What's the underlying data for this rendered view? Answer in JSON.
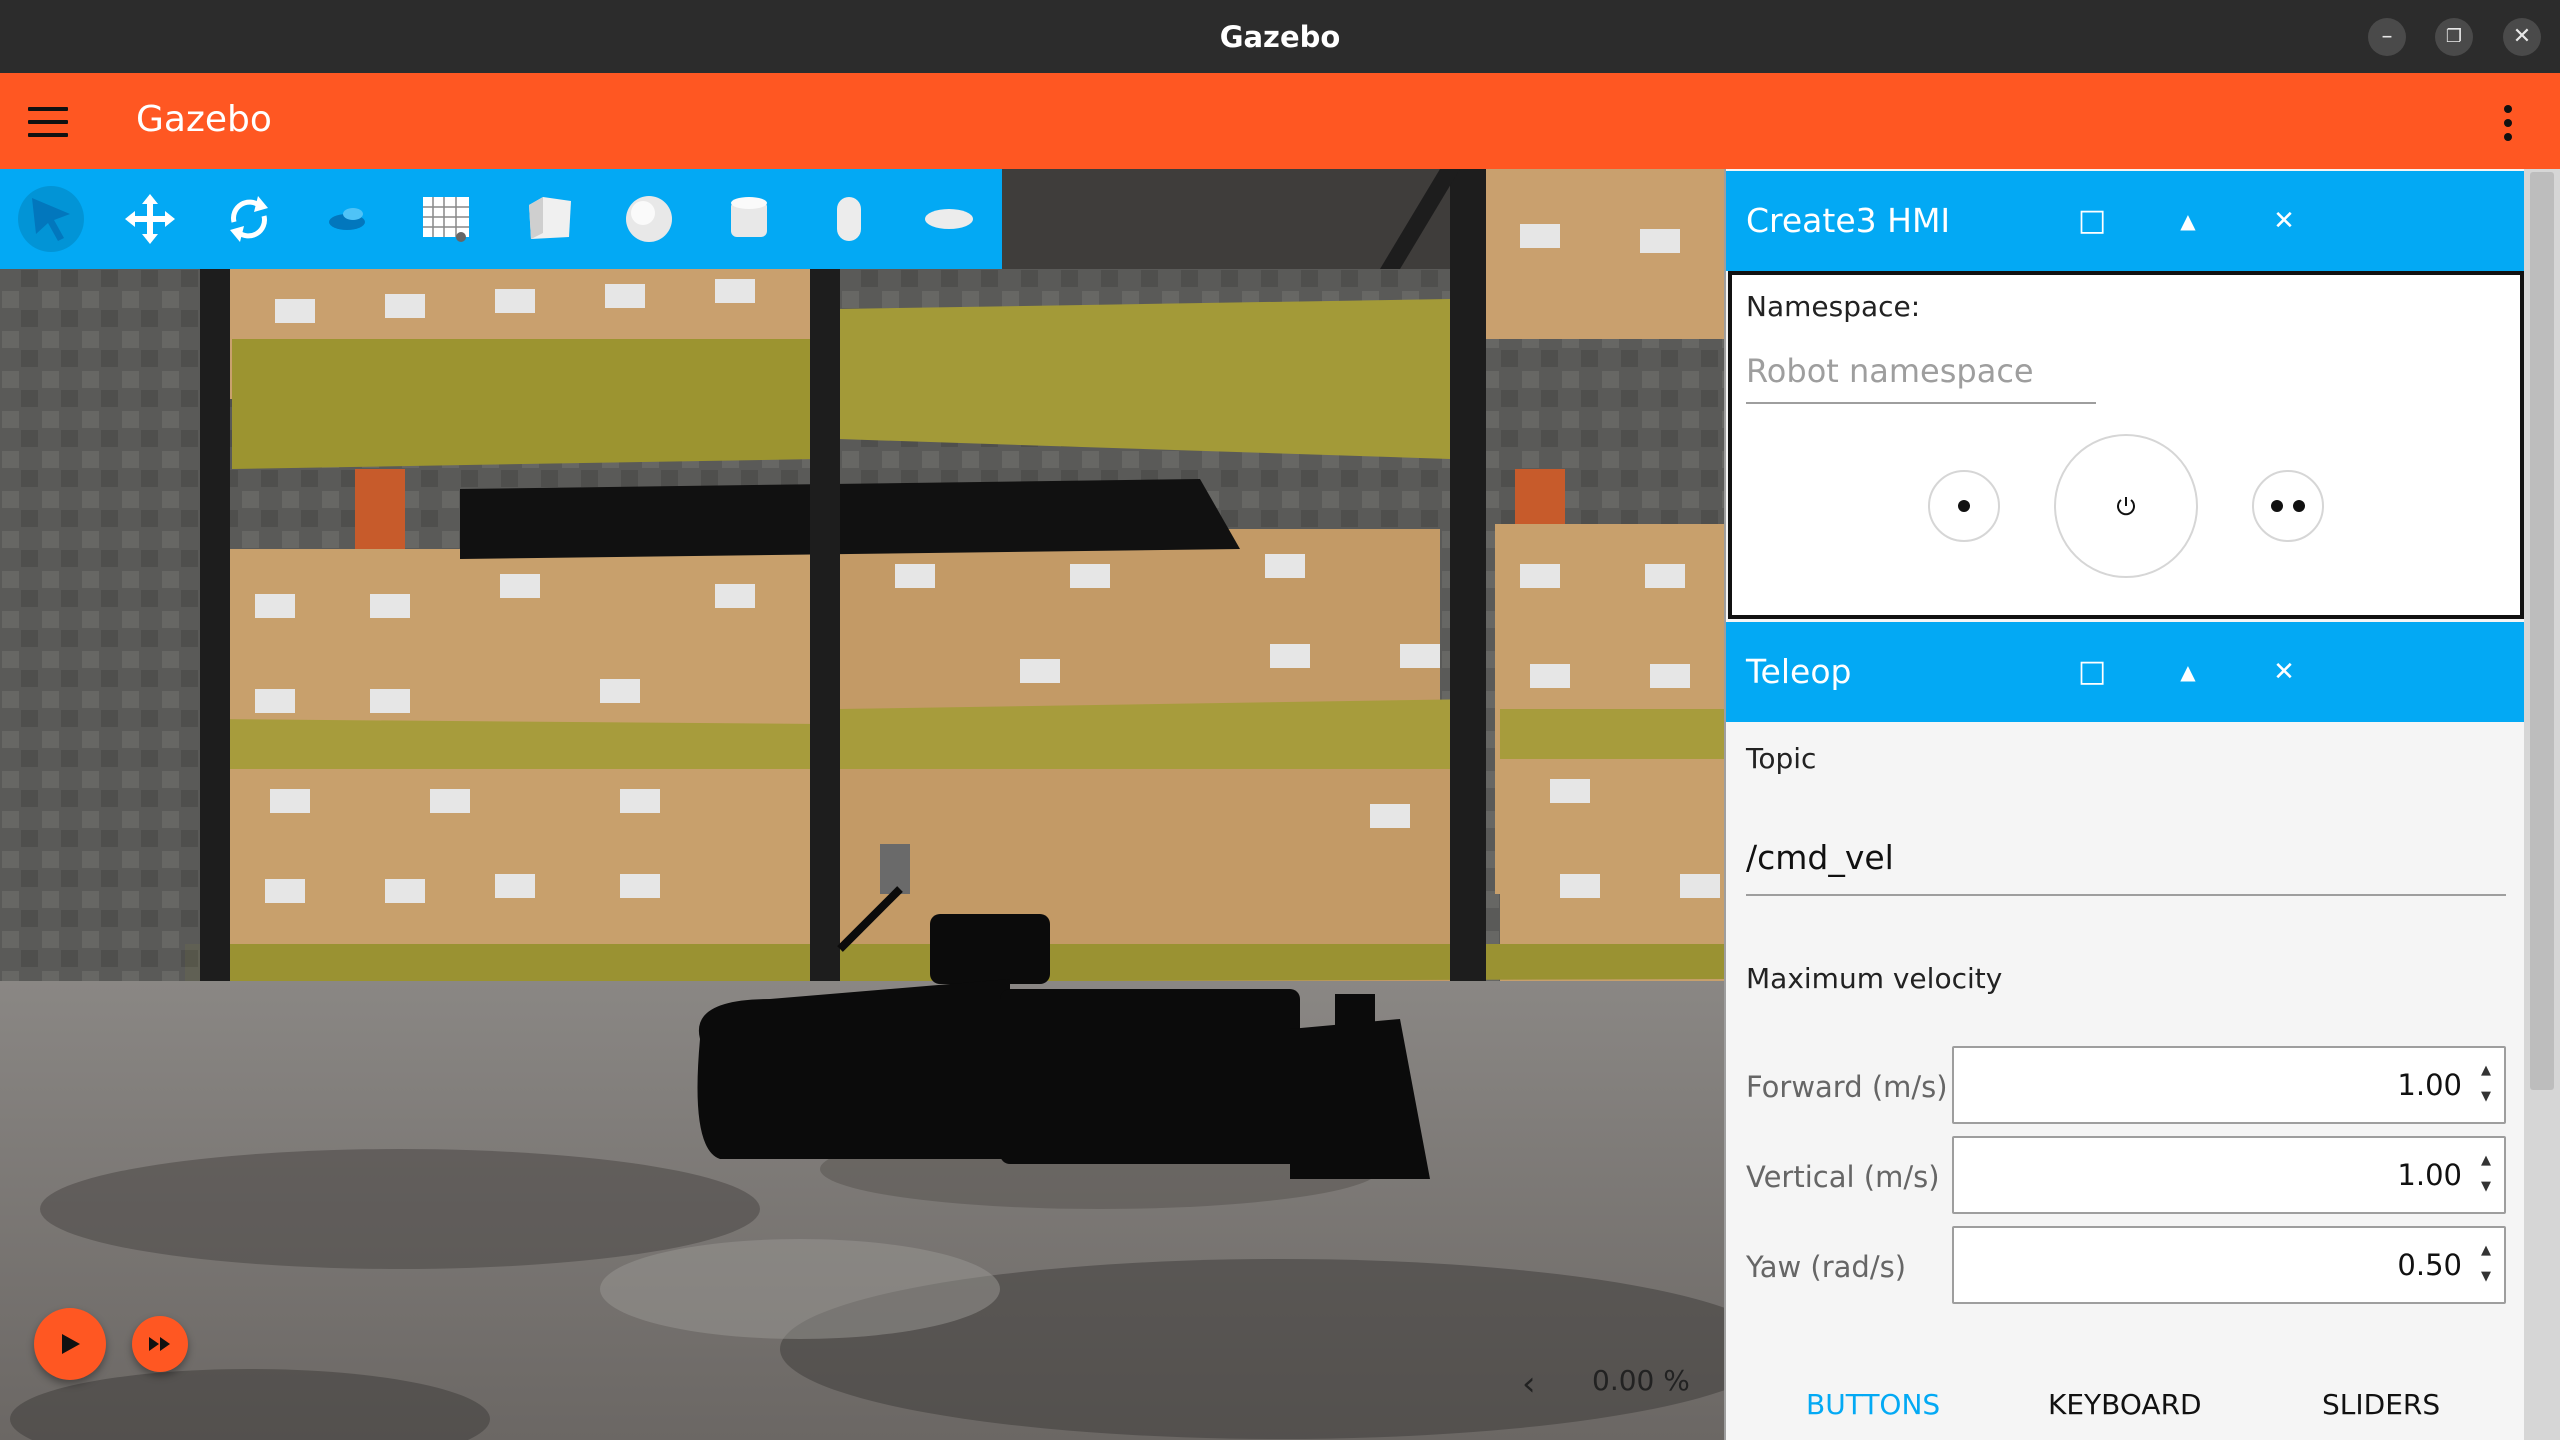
{
  "window": {
    "title": "Gazebo"
  },
  "app_bar": {
    "title": "Gazebo"
  },
  "toolbar": {
    "tools": [
      "select-icon",
      "translate-icon",
      "rotate-icon",
      "transform-control-icon",
      "grid-icon",
      "box-icon",
      "sphere-icon",
      "cylinder-icon",
      "capsule-icon",
      "ellipsoid-icon"
    ]
  },
  "viewport": {
    "real_time_factor": "0.00 %",
    "collapse_arrow": "‹"
  },
  "create3_hmi": {
    "title": "Create3 HMI",
    "namespace_label": "Namespace:",
    "namespace_placeholder": "Robot namespace",
    "namespace_value": ""
  },
  "teleop": {
    "title": "Teleop",
    "topic_label": "Topic",
    "topic_value": "/cmd_vel",
    "max_velocity_label": "Maximum velocity",
    "fields": [
      {
        "label": "Forward (m/s)",
        "value": "1.00"
      },
      {
        "label": "Vertical (m/s)",
        "value": "1.00"
      },
      {
        "label": "Yaw (rad/s)",
        "value": "0.50"
      }
    ],
    "tabs": [
      "BUTTONS",
      "KEYBOARD",
      "SLIDERS"
    ],
    "active_tab": "BUTTONS"
  },
  "colors": {
    "accent": "#ff5722",
    "panel_header": "#03a9f4"
  }
}
